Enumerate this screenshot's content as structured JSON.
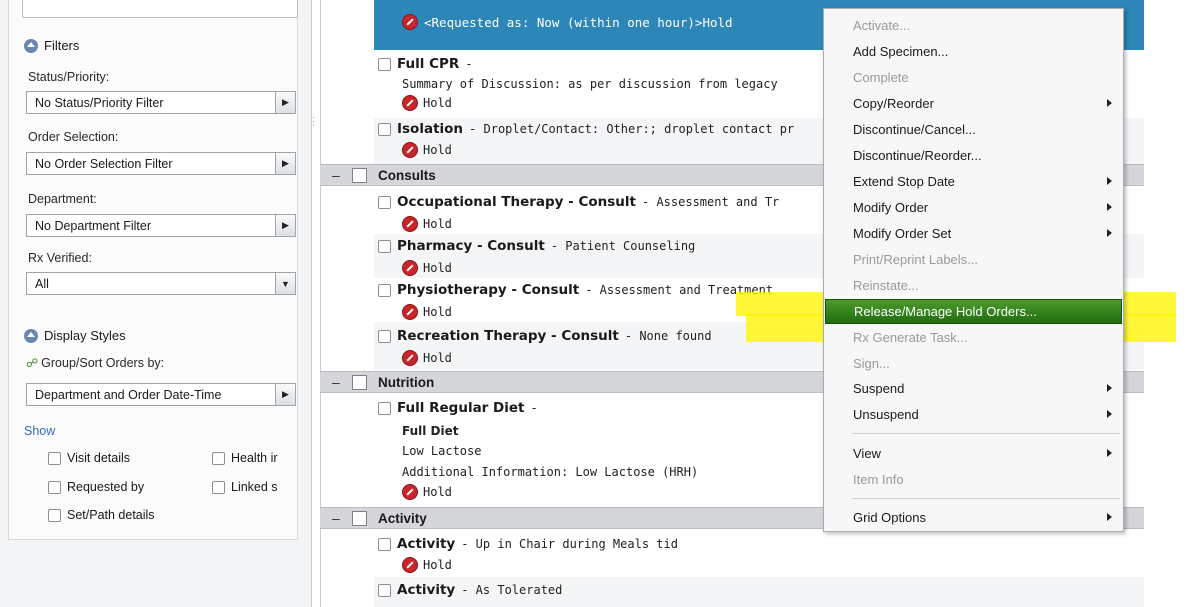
{
  "sidebar": {
    "filters_title": "Filters",
    "status_label": "Status/Priority:",
    "status_value": "No Status/Priority Filter",
    "order_selection_label": "Order Selection:",
    "order_selection_value": "No Order Selection Filter",
    "department_label": "Department:",
    "department_value": "No Department Filter",
    "rx_label": "Rx Verified:",
    "rx_value": "All",
    "display_styles_title": "Display Styles",
    "group_sort_label": "Group/Sort Orders by:",
    "group_sort_value": "Department and Order Date-Time",
    "show_label": "Show",
    "checkboxes": {
      "visit_details": "Visit details",
      "health": "Health ir",
      "requested_by": "Requested by",
      "linked": "Linked s",
      "set_path": "Set/Path details"
    }
  },
  "orders": {
    "selected_text": "<Requested as: Now (within one hour)>Hold",
    "hold_text": "Hold",
    "full_cpr": {
      "name": "Full CPR",
      "suffix": " -",
      "detail": "Summary of Discussion:  as per discussion  from legacy"
    },
    "isolation": {
      "name": "Isolation",
      "detail": " - Droplet/Contact: Other:; droplet contact pr"
    },
    "categories": {
      "consults": "Consults",
      "nutrition": "Nutrition",
      "activity": "Activity"
    },
    "occupational": {
      "name": "Occupational Therapy - Consult",
      "detail": " - Assessment  and Tr"
    },
    "pharmacy": {
      "name": "Pharmacy - Consult",
      "detail": " - Patient Counseling"
    },
    "physiotherapy": {
      "name": "Physiotherapy - Consult",
      "detail": " - Assessment  and Treatment"
    },
    "recreation": {
      "name": "Recreation Therapy - Consult",
      "detail": " - None found"
    },
    "diet": {
      "name": "Full Regular Diet",
      "suffix": " -",
      "line1": "Full Diet",
      "line2": "Low Lactose",
      "line3": "Additional Information: Low Lactose (HRH)"
    },
    "activity1": {
      "name": "Activity",
      "detail": " - Up in Chair during Meals tid"
    },
    "activity2": {
      "name": "Activity",
      "detail": " - As Tolerated"
    }
  },
  "context_menu": {
    "activate": "Activate...",
    "add_specimen": "Add Specimen...",
    "complete": "Complete",
    "copy_reorder": "Copy/Reorder",
    "discontinue_cancel": "Discontinue/Cancel...",
    "discontinue_reorder": "Discontinue/Reorder...",
    "extend_stop": "Extend Stop Date",
    "modify_order": "Modify Order",
    "modify_order_set": "Modify Order Set",
    "print_labels": "Print/Reprint Labels...",
    "reinstate": "Reinstate...",
    "release_hold": "Release/Manage Hold Orders...",
    "rx_generate": "Rx Generate Task...",
    "sign": "Sign...",
    "suspend": "Suspend",
    "unsuspend": "Unsuspend",
    "view": "View",
    "item_info": "Item Info",
    "grid_options": "Grid Options"
  },
  "colors": {
    "selected_row": "#2d86b8",
    "menu_highlight": "#2f7f1c",
    "hold_icon": "#c8262b",
    "highlighter": "#fff500"
  }
}
